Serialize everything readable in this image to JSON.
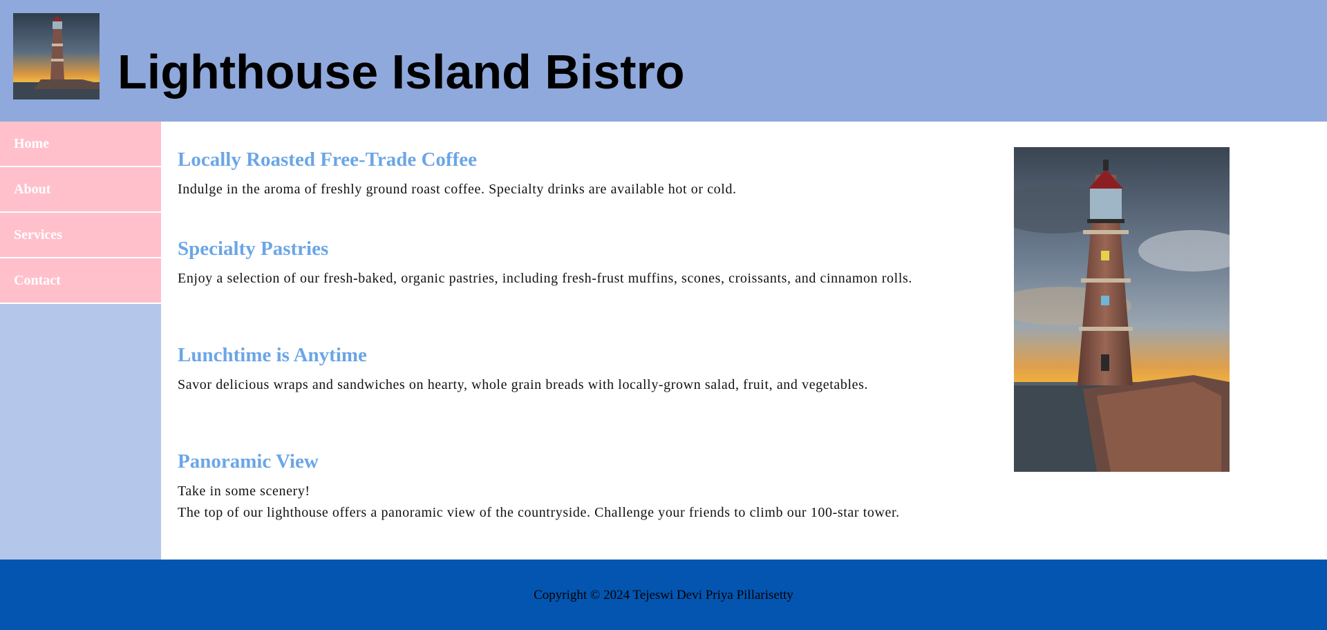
{
  "header": {
    "title": "Lighthouse Island Bistro",
    "logo_icon": "lighthouse-logo"
  },
  "nav": {
    "items": [
      {
        "label": "Home"
      },
      {
        "label": "About"
      },
      {
        "label": "Services"
      },
      {
        "label": "Contact"
      }
    ]
  },
  "main": {
    "sections": [
      {
        "heading": "Locally Roasted Free-Trade Coffee",
        "paragraphs": [
          "Indulge in the aroma of freshly ground roast coffee. Specialty drinks are available hot or cold."
        ]
      },
      {
        "heading": "Specialty Pastries",
        "paragraphs": [
          "Enjoy a selection of our fresh-baked, organic pastries, including fresh-frust muffins, scones, croissants, and cinnamon rolls."
        ]
      },
      {
        "heading": "Lunchtime is Anytime",
        "paragraphs": [
          "Savor delicious wraps and sandwiches on hearty, whole grain breads with locally-grown salad, fruit, and vegetables."
        ]
      },
      {
        "heading": "Panoramic View",
        "paragraphs": [
          "Take in some scenery!",
          "The top of our lighthouse offers a panoramic view of the countryside. Challenge your friends to climb our 100-star tower."
        ]
      }
    ]
  },
  "photo": {
    "icon": "lighthouse-photo"
  },
  "footer": {
    "copyright": "Copyright © 2024 Tejeswi Devi Priya Pillarisetty"
  },
  "colors": {
    "header_bg": "#90a9dc",
    "sidebar_bg": "#b4c6e9",
    "nav_bg": "#ffc0cc",
    "heading": "#6ba6e6",
    "footer_bg": "#0355b0"
  }
}
